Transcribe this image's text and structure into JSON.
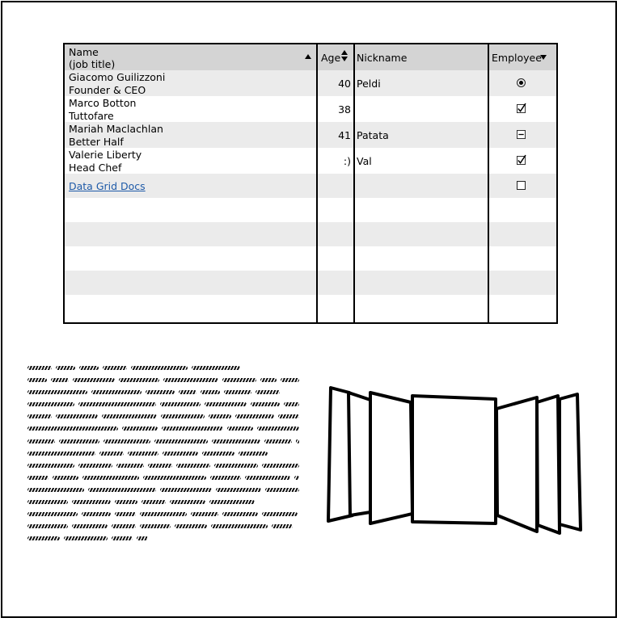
{
  "grid": {
    "headers": {
      "name_line1": "Name",
      "name_line2": "(job title)",
      "age": "Age",
      "nickname": "Nickname",
      "employee": "Employee"
    },
    "rows": [
      {
        "name": "Giacomo Guilizzoni",
        "title": "Founder & CEO",
        "age": "40",
        "nickname": "Peldi",
        "employee": "radio-selected"
      },
      {
        "name": "Marco Botton",
        "title": "Tuttofare",
        "age": "38",
        "nickname": "",
        "employee": "checked"
      },
      {
        "name": "Mariah Maclachlan",
        "title": "Better Half",
        "age": "41",
        "nickname": "Patata",
        "employee": "indeterminate"
      },
      {
        "name": "Valerie Liberty",
        "title": "Head Chef",
        "age": ":)",
        "nickname": "Val",
        "employee": "checked"
      }
    ],
    "link_row": {
      "label": "Data Grid Docs",
      "employee": "unchecked"
    },
    "colors": {
      "header_bg": "#d4d4d4",
      "alt_row_bg": "#ebebeb",
      "link": "#1e5aa8"
    }
  },
  "icons": {
    "name_sort": "sort-ascending-icon",
    "age_sort": "sort-both-icon",
    "employee_sort": "sort-descending-icon"
  },
  "placeholder_text_block": "lorem-ipsum-scribble",
  "cover_flow": {
    "items": 7
  }
}
